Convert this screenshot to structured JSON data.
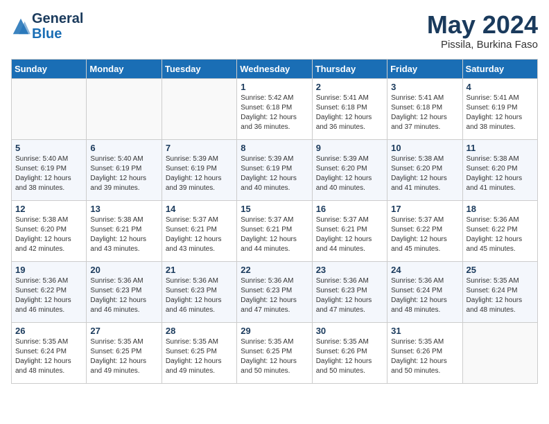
{
  "header": {
    "logo_line1": "General",
    "logo_line2": "Blue",
    "title": "May 2024",
    "subtitle": "Pissila, Burkina Faso"
  },
  "weekdays": [
    "Sunday",
    "Monday",
    "Tuesday",
    "Wednesday",
    "Thursday",
    "Friday",
    "Saturday"
  ],
  "weeks": [
    [
      {
        "day": "",
        "sunrise": "",
        "sunset": "",
        "daylight": ""
      },
      {
        "day": "",
        "sunrise": "",
        "sunset": "",
        "daylight": ""
      },
      {
        "day": "",
        "sunrise": "",
        "sunset": "",
        "daylight": ""
      },
      {
        "day": "1",
        "sunrise": "Sunrise: 5:42 AM",
        "sunset": "Sunset: 6:18 PM",
        "daylight": "Daylight: 12 hours and 36 minutes."
      },
      {
        "day": "2",
        "sunrise": "Sunrise: 5:41 AM",
        "sunset": "Sunset: 6:18 PM",
        "daylight": "Daylight: 12 hours and 36 minutes."
      },
      {
        "day": "3",
        "sunrise": "Sunrise: 5:41 AM",
        "sunset": "Sunset: 6:18 PM",
        "daylight": "Daylight: 12 hours and 37 minutes."
      },
      {
        "day": "4",
        "sunrise": "Sunrise: 5:41 AM",
        "sunset": "Sunset: 6:19 PM",
        "daylight": "Daylight: 12 hours and 38 minutes."
      }
    ],
    [
      {
        "day": "5",
        "sunrise": "Sunrise: 5:40 AM",
        "sunset": "Sunset: 6:19 PM",
        "daylight": "Daylight: 12 hours and 38 minutes."
      },
      {
        "day": "6",
        "sunrise": "Sunrise: 5:40 AM",
        "sunset": "Sunset: 6:19 PM",
        "daylight": "Daylight: 12 hours and 39 minutes."
      },
      {
        "day": "7",
        "sunrise": "Sunrise: 5:39 AM",
        "sunset": "Sunset: 6:19 PM",
        "daylight": "Daylight: 12 hours and 39 minutes."
      },
      {
        "day": "8",
        "sunrise": "Sunrise: 5:39 AM",
        "sunset": "Sunset: 6:19 PM",
        "daylight": "Daylight: 12 hours and 40 minutes."
      },
      {
        "day": "9",
        "sunrise": "Sunrise: 5:39 AM",
        "sunset": "Sunset: 6:20 PM",
        "daylight": "Daylight: 12 hours and 40 minutes."
      },
      {
        "day": "10",
        "sunrise": "Sunrise: 5:38 AM",
        "sunset": "Sunset: 6:20 PM",
        "daylight": "Daylight: 12 hours and 41 minutes."
      },
      {
        "day": "11",
        "sunrise": "Sunrise: 5:38 AM",
        "sunset": "Sunset: 6:20 PM",
        "daylight": "Daylight: 12 hours and 41 minutes."
      }
    ],
    [
      {
        "day": "12",
        "sunrise": "Sunrise: 5:38 AM",
        "sunset": "Sunset: 6:20 PM",
        "daylight": "Daylight: 12 hours and 42 minutes."
      },
      {
        "day": "13",
        "sunrise": "Sunrise: 5:38 AM",
        "sunset": "Sunset: 6:21 PM",
        "daylight": "Daylight: 12 hours and 43 minutes."
      },
      {
        "day": "14",
        "sunrise": "Sunrise: 5:37 AM",
        "sunset": "Sunset: 6:21 PM",
        "daylight": "Daylight: 12 hours and 43 minutes."
      },
      {
        "day": "15",
        "sunrise": "Sunrise: 5:37 AM",
        "sunset": "Sunset: 6:21 PM",
        "daylight": "Daylight: 12 hours and 44 minutes."
      },
      {
        "day": "16",
        "sunrise": "Sunrise: 5:37 AM",
        "sunset": "Sunset: 6:21 PM",
        "daylight": "Daylight: 12 hours and 44 minutes."
      },
      {
        "day": "17",
        "sunrise": "Sunrise: 5:37 AM",
        "sunset": "Sunset: 6:22 PM",
        "daylight": "Daylight: 12 hours and 45 minutes."
      },
      {
        "day": "18",
        "sunrise": "Sunrise: 5:36 AM",
        "sunset": "Sunset: 6:22 PM",
        "daylight": "Daylight: 12 hours and 45 minutes."
      }
    ],
    [
      {
        "day": "19",
        "sunrise": "Sunrise: 5:36 AM",
        "sunset": "Sunset: 6:22 PM",
        "daylight": "Daylight: 12 hours and 46 minutes."
      },
      {
        "day": "20",
        "sunrise": "Sunrise: 5:36 AM",
        "sunset": "Sunset: 6:23 PM",
        "daylight": "Daylight: 12 hours and 46 minutes."
      },
      {
        "day": "21",
        "sunrise": "Sunrise: 5:36 AM",
        "sunset": "Sunset: 6:23 PM",
        "daylight": "Daylight: 12 hours and 46 minutes."
      },
      {
        "day": "22",
        "sunrise": "Sunrise: 5:36 AM",
        "sunset": "Sunset: 6:23 PM",
        "daylight": "Daylight: 12 hours and 47 minutes."
      },
      {
        "day": "23",
        "sunrise": "Sunrise: 5:36 AM",
        "sunset": "Sunset: 6:23 PM",
        "daylight": "Daylight: 12 hours and 47 minutes."
      },
      {
        "day": "24",
        "sunrise": "Sunrise: 5:36 AM",
        "sunset": "Sunset: 6:24 PM",
        "daylight": "Daylight: 12 hours and 48 minutes."
      },
      {
        "day": "25",
        "sunrise": "Sunrise: 5:35 AM",
        "sunset": "Sunset: 6:24 PM",
        "daylight": "Daylight: 12 hours and 48 minutes."
      }
    ],
    [
      {
        "day": "26",
        "sunrise": "Sunrise: 5:35 AM",
        "sunset": "Sunset: 6:24 PM",
        "daylight": "Daylight: 12 hours and 48 minutes."
      },
      {
        "day": "27",
        "sunrise": "Sunrise: 5:35 AM",
        "sunset": "Sunset: 6:25 PM",
        "daylight": "Daylight: 12 hours and 49 minutes."
      },
      {
        "day": "28",
        "sunrise": "Sunrise: 5:35 AM",
        "sunset": "Sunset: 6:25 PM",
        "daylight": "Daylight: 12 hours and 49 minutes."
      },
      {
        "day": "29",
        "sunrise": "Sunrise: 5:35 AM",
        "sunset": "Sunset: 6:25 PM",
        "daylight": "Daylight: 12 hours and 50 minutes."
      },
      {
        "day": "30",
        "sunrise": "Sunrise: 5:35 AM",
        "sunset": "Sunset: 6:26 PM",
        "daylight": "Daylight: 12 hours and 50 minutes."
      },
      {
        "day": "31",
        "sunrise": "Sunrise: 5:35 AM",
        "sunset": "Sunset: 6:26 PM",
        "daylight": "Daylight: 12 hours and 50 minutes."
      },
      {
        "day": "",
        "sunrise": "",
        "sunset": "",
        "daylight": ""
      }
    ]
  ]
}
